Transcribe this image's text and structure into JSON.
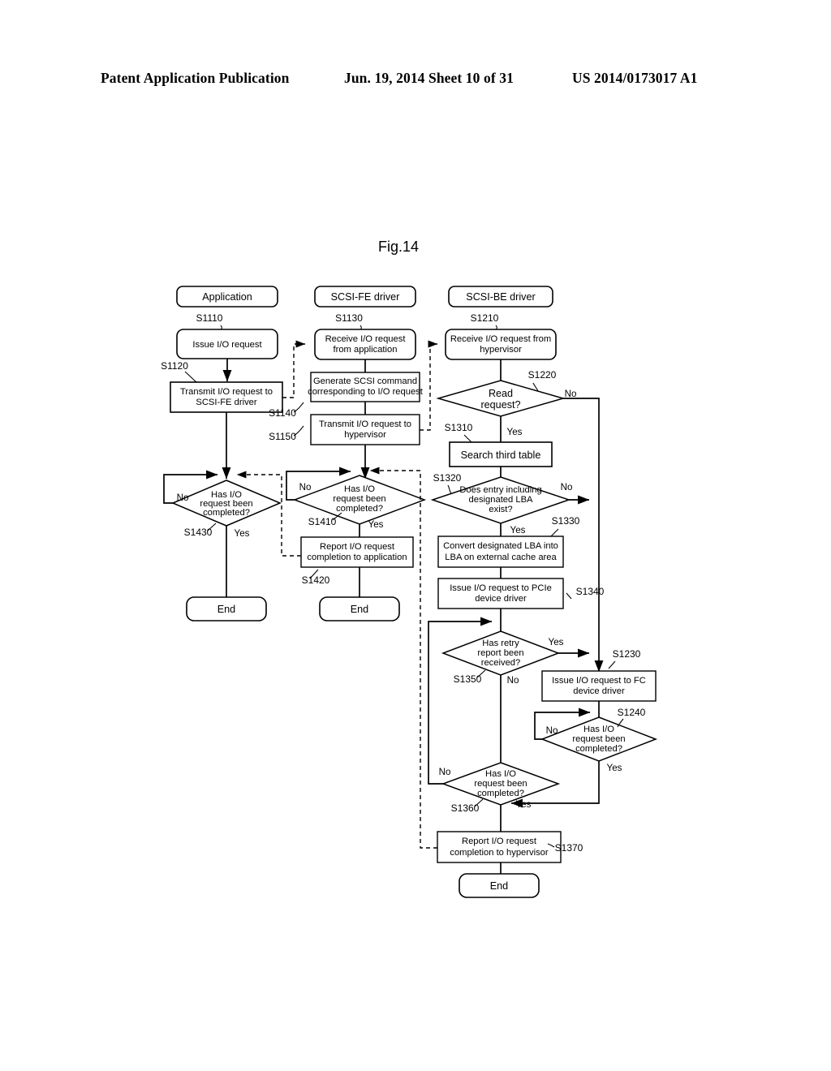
{
  "header": {
    "publication": "Patent Application Publication",
    "date_sheet": "Jun. 19, 2014  Sheet 10 of 31",
    "patent_number": "US 2014/0173017 A1"
  },
  "figure": {
    "label": "Fig.14",
    "lanes": [
      {
        "id": "lane-application",
        "title": "Application"
      },
      {
        "id": "lane-scsi-fe",
        "title": "SCSI-FE driver"
      },
      {
        "id": "lane-scsi-be",
        "title": "SCSI-BE driver"
      }
    ],
    "nodes": {
      "s1110": {
        "step": "S1110",
        "text": [
          "Issue I/O request"
        ]
      },
      "s1120": {
        "step": "S1120",
        "text": [
          "Transmit I/O request to",
          "SCSI-FE driver"
        ]
      },
      "s1430": {
        "step": "S1430",
        "text": [
          "Has I/O",
          "request been",
          "completed?"
        ]
      },
      "end_left": {
        "text": [
          "End"
        ]
      },
      "s1130": {
        "step": "S1130",
        "text": [
          "Receive I/O request",
          "from application"
        ]
      },
      "s1140": {
        "step": "S1140",
        "text": [
          "Generate SCSI command",
          "corresponding to I/O request"
        ]
      },
      "s1150": {
        "step": "S1150",
        "text": [
          "Transmit I/O request to",
          "hypervisor"
        ]
      },
      "s1410": {
        "step": "S1410",
        "text": [
          "Has I/O",
          "request been",
          "completed?"
        ]
      },
      "s1420": {
        "step": "S1420",
        "text": [
          "Report I/O request",
          "completion to application"
        ]
      },
      "end_mid": {
        "text": [
          "End"
        ]
      },
      "s1210": {
        "step": "S1210",
        "text": [
          "Receive I/O request from",
          "hypervisor"
        ]
      },
      "s1220": {
        "step": "S1220",
        "text": [
          "Read",
          "request?"
        ]
      },
      "s1310": {
        "step": "S1310",
        "text": [
          "Search third table"
        ]
      },
      "s1320": {
        "step": "S1320",
        "text": [
          "Does entry including",
          "designated LBA",
          "exist?"
        ]
      },
      "s1330": {
        "step": "S1330",
        "text": [
          "Convert designated LBA into",
          "LBA on external cache area"
        ]
      },
      "s1340": {
        "step": "S1340",
        "text": [
          "Issue I/O request to PCIe",
          "device driver"
        ]
      },
      "s1350": {
        "step": "S1350",
        "text": [
          "Has retry",
          "report been",
          "received?"
        ]
      },
      "s1230": {
        "step": "S1230",
        "text": [
          "Issue I/O request to FC",
          "device driver"
        ]
      },
      "s1240": {
        "step": "S1240",
        "text": [
          "Has I/O",
          "request been",
          "completed?"
        ]
      },
      "s1360": {
        "step": "S1360",
        "text": [
          "Has I/O",
          "request been",
          "completed?"
        ]
      },
      "s1370": {
        "step": "S1370",
        "text": [
          "Report I/O request",
          "completion to hypervisor"
        ]
      },
      "end_right": {
        "text": [
          "End"
        ]
      }
    },
    "branch_labels": {
      "yes": "Yes",
      "no": "No"
    }
  }
}
